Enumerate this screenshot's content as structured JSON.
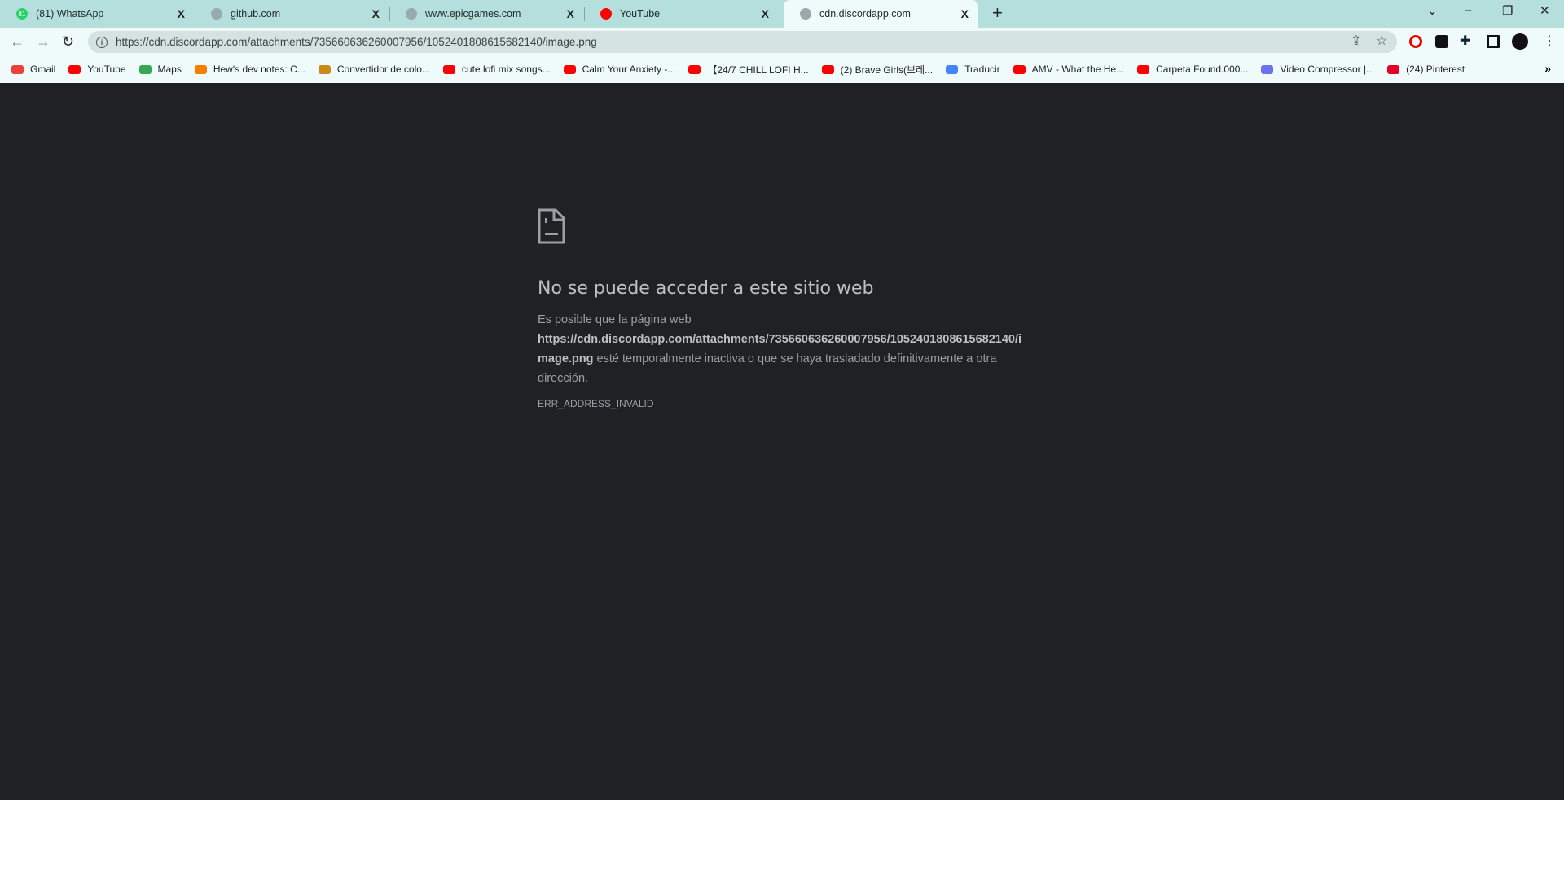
{
  "tabs": [
    {
      "title": "(81) WhatsApp",
      "icon": "whatsapp-icon",
      "badge": "81",
      "color": "#25d366"
    },
    {
      "title": "github.com",
      "icon": "globe-icon",
      "color": "#9aa"
    },
    {
      "title": "www.epicgames.com",
      "icon": "globe-icon",
      "color": "#9aa"
    },
    {
      "title": "YouTube",
      "icon": "youtube-icon",
      "color": "#ff0000"
    },
    {
      "title": "cdn.discordapp.com",
      "icon": "globe-icon",
      "color": "#9aa",
      "active": true
    }
  ],
  "close_glyph": "X",
  "new_tab_glyph": "+",
  "address": "https://cdn.discordapp.com/attachments/735660636260007956/1052401808615682140/image.png",
  "bookmarks": [
    {
      "label": "Gmail",
      "color": "#ea4335"
    },
    {
      "label": "YouTube",
      "color": "#ff0000"
    },
    {
      "label": "Maps",
      "color": "#34a853"
    },
    {
      "label": "Hew's dev notes: C...",
      "color": "#f57d00"
    },
    {
      "label": "Convertidor de colo...",
      "color": "#c98a1a"
    },
    {
      "label": "cute lofi mix songs...",
      "color": "#ff0000"
    },
    {
      "label": "Calm Your Anxiety -...",
      "color": "#ff0000"
    },
    {
      "label": "【24/7 CHILL LOFI H...",
      "color": "#ff0000"
    },
    {
      "label": "(2) Brave Girls(브레...",
      "color": "#ff0000"
    },
    {
      "label": "Traducir",
      "color": "#4285f4"
    },
    {
      "label": "AMV - What the He...",
      "color": "#ff0000"
    },
    {
      "label": "Carpeta Found.000...",
      "color": "#ff0000"
    },
    {
      "label": "Video Compressor |...",
      "color": "#6b72f0"
    },
    {
      "label": "(24) Pinterest",
      "color": "#e60023"
    }
  ],
  "error": {
    "title": "No se puede acceder a este sitio web",
    "line1": "Es posible que la página web",
    "url": "https://cdn.discordapp.com/attachments/735660636260007956/1052401808615682140/image.png",
    "line2": " esté temporalmente inactiva o que se haya trasladado definitivamente a otra dirección.",
    "code": "ERR_ADDRESS_INVALID"
  }
}
